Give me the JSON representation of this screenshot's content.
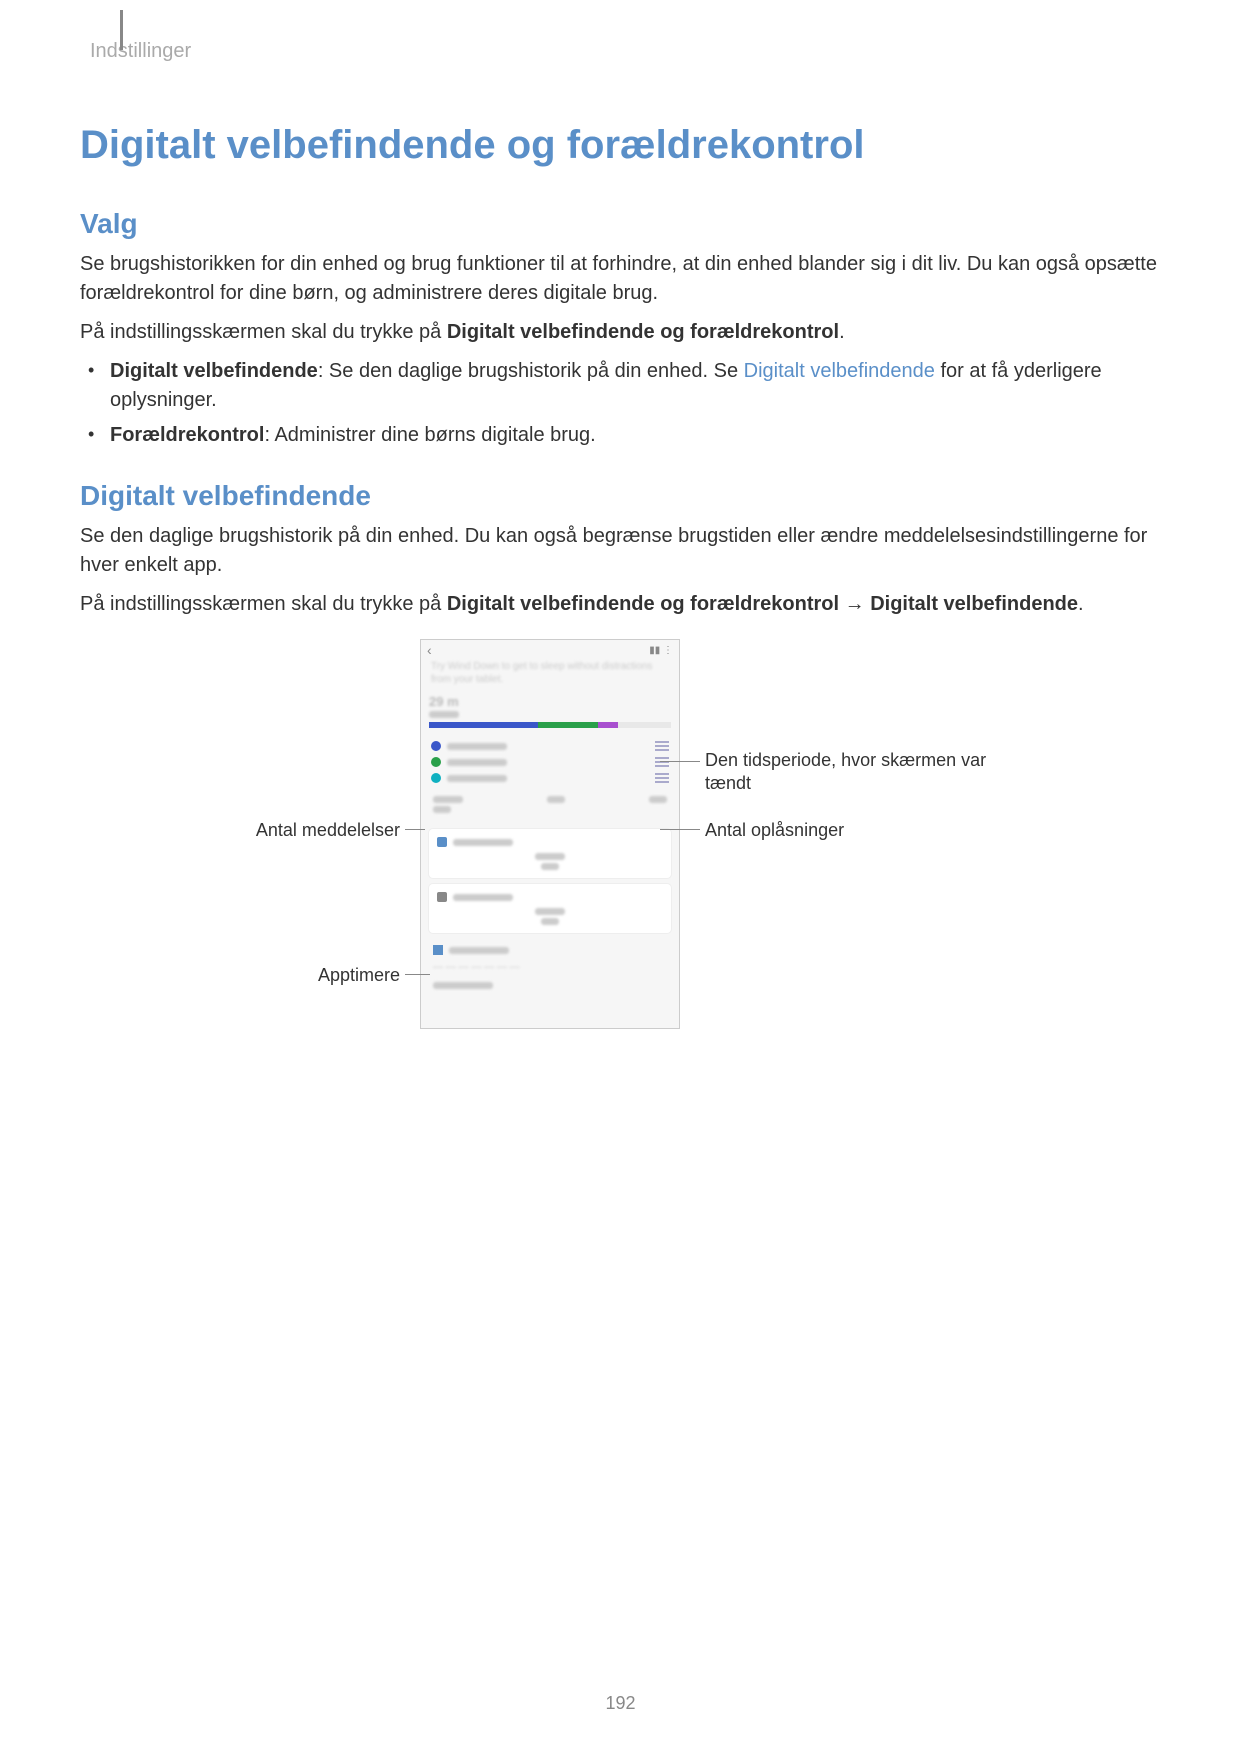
{
  "breadcrumb": "Indstillinger",
  "title": "Digitalt velbefindende og forældrekontrol",
  "section_valg": {
    "heading": "Valg",
    "p1": "Se brugshistorikken for din enhed og brug funktioner til at forhindre, at din enhed blander sig i dit liv. Du kan også opsætte forældrekontrol for dine børn, og administrere deres digitale brug.",
    "p2_pre": "På indstillingsskærmen skal du trykke på ",
    "p2_bold": "Digitalt velbefindende og forældrekontrol",
    "p2_post": ".",
    "bullets": [
      {
        "bold": "Digitalt velbefindende",
        "mid": ": Se den daglige brugshistorik på din enhed. Se ",
        "link": "Digitalt velbefindende",
        "tail": " for at få yderligere oplysninger."
      },
      {
        "bold": "Forældrekontrol",
        "mid": ": Administrer dine børns digitale brug.",
        "link": "",
        "tail": ""
      }
    ]
  },
  "section_dv": {
    "heading": "Digitalt velbefindende",
    "p1": "Se den daglige brugshistorik på din enhed. Du kan også begrænse brugstiden eller ændre meddelelsesindstillingerne for hver enkelt app.",
    "p2_pre": "På indstillingsskærmen skal du trykke på ",
    "p2_bold1": "Digitalt velbefindende og forældrekontrol",
    "p2_arrow": " → ",
    "p2_bold2": "Digitalt velbefindende",
    "p2_post": "."
  },
  "figure": {
    "callout_left_top": "Antal meddelelser",
    "callout_left_bottom": "Apptimere",
    "callout_right_top": "Den tidsperiode, hvor skærmen var tændt",
    "callout_right_bottom": "Antal oplåsninger",
    "phone": {
      "back_glyph": "‹",
      "signal": "▮▮",
      "more": "⋮",
      "hint": "Try Wind Down to get to sleep without distractions from your tablet.",
      "stat": "29 m"
    }
  },
  "page_number": "192"
}
